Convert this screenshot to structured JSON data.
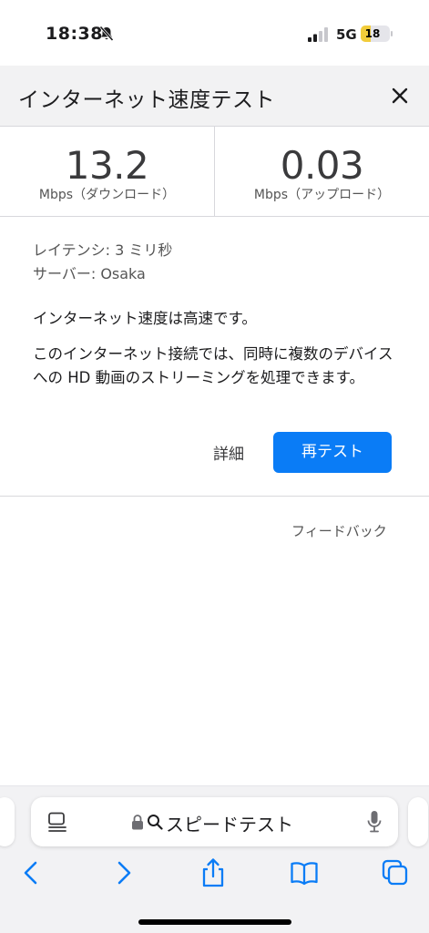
{
  "status_bar": {
    "time": "18:38",
    "network": "5G",
    "battery_level": "18",
    "battery_fraction": 0.18
  },
  "header": {
    "title": "インターネット速度テスト"
  },
  "speeds": {
    "download_value": "13.2",
    "download_unit": "Mbps（ダウンロード）",
    "upload_value": "0.03",
    "upload_unit": "Mbps（アップロード）"
  },
  "info": {
    "latency": "レイテンシ: 3 ミリ秒",
    "server": "サーバー: Osaka"
  },
  "status_message": "インターネット速度は高速です。",
  "detail_message": "このインターネット接続では、同時に複数のデバイスへの HD 動画のストリーミングを処理できます。",
  "actions": {
    "detail_label": "詳細",
    "retest_label": "再テスト",
    "feedback_label": "フィードバック"
  },
  "address_bar": {
    "text": "スピードテスト"
  },
  "colors": {
    "accent": "#0a7cf6",
    "battery": "#f2cc3a"
  }
}
